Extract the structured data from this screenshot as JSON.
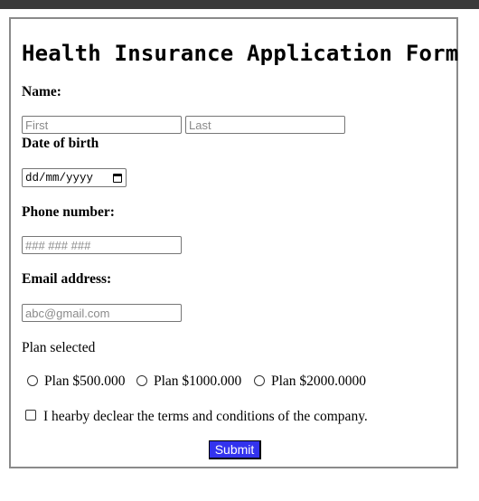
{
  "form": {
    "title": "Health Insurance Application Form",
    "name": {
      "label": "Name:",
      "first_placeholder": "First",
      "last_placeholder": "Last"
    },
    "dob": {
      "label": "Date of birth",
      "placeholder": "dd/mm/yyyy",
      "icon": "calendar-icon"
    },
    "phone": {
      "label": "Phone number:",
      "placeholder": "### ### ###"
    },
    "email": {
      "label": "Email address:",
      "placeholder": "abc@gmail.com"
    },
    "plan": {
      "label": "Plan selected",
      "options": [
        {
          "label": "Plan $500.000",
          "selected": false
        },
        {
          "label": "Plan $1000.000",
          "selected": false
        },
        {
          "label": "Plan $2000.0000",
          "selected": false
        }
      ]
    },
    "declaration": {
      "label": "I hearby declear the terms and conditions of the company.",
      "checked": false
    },
    "submit_label": "Submit"
  },
  "colors": {
    "submit_bg": "#3333ee",
    "submit_text": "#ffffff",
    "border": "#8a8a8a",
    "topbar": "#3a3a3a"
  }
}
